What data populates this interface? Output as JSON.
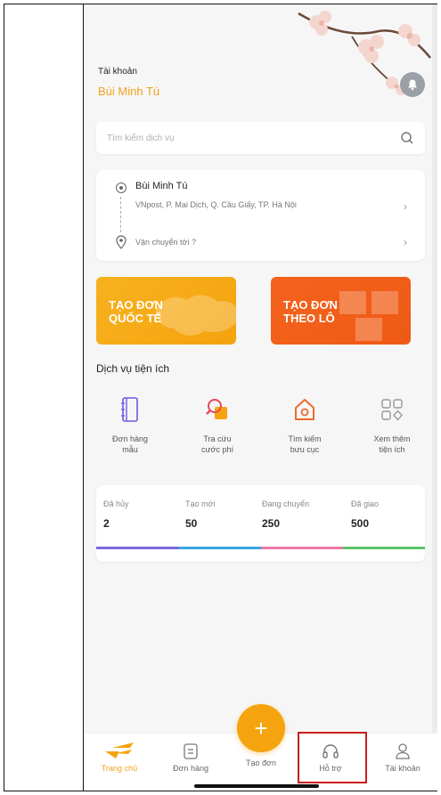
{
  "account": {
    "label": "Tài khoản",
    "name": "Bùi Minh Tú"
  },
  "search": {
    "placeholder": "Tìm kiếm dịch vụ"
  },
  "address": {
    "sender_name": "Bùi Minh Tú",
    "sender_detail": "VNpost, P. Mai Dịch, Q. Cầu Giấy, TP. Hà Nội",
    "destination_placeholder": "Vận chuyển tới ?"
  },
  "promos": [
    {
      "line1": "TẠO ĐƠN",
      "line2": "QUỐC TẾ",
      "color": "#f6b21e"
    },
    {
      "line1": "TẠO ĐƠN",
      "line2": "THEO LÔ",
      "color": "#f4631e"
    }
  ],
  "services": {
    "title": "Dịch vụ tiện ích",
    "items": [
      {
        "line1": "Đơn hàng",
        "line2": "mẫu",
        "icon": "notebook-icon"
      },
      {
        "line1": "Tra cứu",
        "line2": "cước phí",
        "icon": "search-fee-icon"
      },
      {
        "line1": "Tìm kiếm",
        "line2": "bưu cục",
        "icon": "post-office-icon"
      },
      {
        "line1": "Xem thêm",
        "line2": "tiện ích",
        "icon": "grid-more-icon"
      }
    ]
  },
  "stats": [
    {
      "label": "Đã hủy",
      "value": "2",
      "color": "#7b6cdb"
    },
    {
      "label": "Tạo mới",
      "value": "50",
      "color": "#3aa6e0"
    },
    {
      "label": "Đang chuyển",
      "value": "250",
      "color": "#e97aa6"
    },
    {
      "label": "Đã giao",
      "value": "500",
      "color": "#5cc46a"
    }
  ],
  "tabbar": {
    "home": "Trang chủ",
    "orders": "Đơn hàng",
    "create": "Tạo đơn",
    "create_symbol": "+",
    "support": "Hỗ trợ",
    "account": "Tài khoản"
  },
  "colors": {
    "accent": "#f5a40f",
    "highlight": "#c91d1d"
  }
}
